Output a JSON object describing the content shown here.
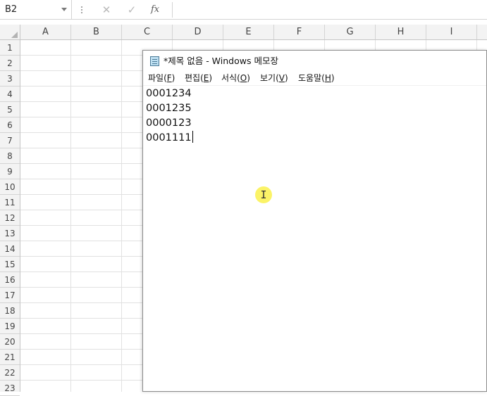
{
  "formula_bar": {
    "name_box": "B2",
    "cancel_icon": "✕",
    "enter_icon": "✓",
    "fx_label": "fx",
    "formula_value": ""
  },
  "sheet": {
    "columns": [
      "A",
      "B",
      "C",
      "D",
      "E",
      "F",
      "G",
      "H",
      "I"
    ],
    "rows": [
      "1",
      "2",
      "3",
      "4",
      "5",
      "6",
      "7",
      "8",
      "9",
      "10",
      "11",
      "12",
      "13",
      "14",
      "15",
      "16",
      "17",
      "18",
      "19",
      "20",
      "21",
      "22",
      "23"
    ]
  },
  "notepad": {
    "title": "*제목 없음 - Windows 메모장",
    "menu": [
      {
        "label": "파일(",
        "key": "F",
        "suffix": ")"
      },
      {
        "label": "편집(",
        "key": "E",
        "suffix": ")"
      },
      {
        "label": "서식(",
        "key": "O",
        "suffix": ")"
      },
      {
        "label": "보기(",
        "key": "V",
        "suffix": ")"
      },
      {
        "label": "도움말(",
        "key": "H",
        "suffix": ")"
      }
    ],
    "lines": [
      "0001234",
      "0001235",
      "0000123",
      "0001111"
    ]
  },
  "cursor": {
    "glyph": "I",
    "highlight_color": "#faf046"
  }
}
